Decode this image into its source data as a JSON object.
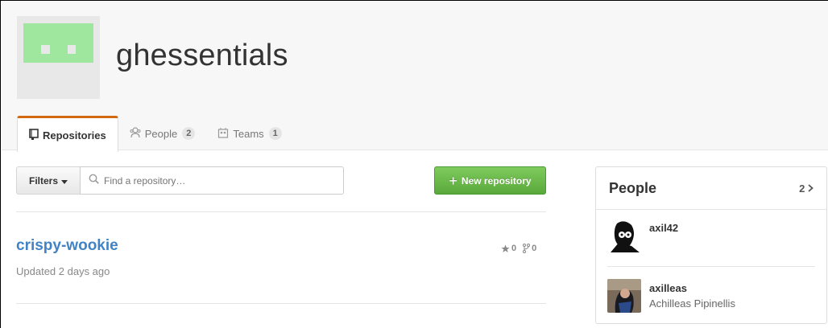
{
  "org": {
    "name": "ghessentials",
    "avatar_color": "#9fe69f"
  },
  "tabs": [
    {
      "label": "Repositories",
      "icon": "repo-icon",
      "active": true
    },
    {
      "label": "People",
      "icon": "people-icon",
      "count": "2"
    },
    {
      "label": "Teams",
      "icon": "teams-icon",
      "count": "1"
    }
  ],
  "toolbar": {
    "filters_label": "Filters",
    "search_placeholder": "Find a repository…",
    "new_repo_label": "New repository",
    "new_repo_color": "#6cc04a"
  },
  "repos": [
    {
      "name": "crispy-wookie",
      "updated": "Updated 2 days ago",
      "stars": "0",
      "forks": "0"
    }
  ],
  "people": {
    "title": "People",
    "count": "2",
    "members": [
      {
        "login": "axil42",
        "fullname": ""
      },
      {
        "login": "axilleas",
        "fullname": "Achilleas Pipinellis"
      }
    ]
  },
  "colors": {
    "accent_tab": "#d26911",
    "link": "#4183c4"
  }
}
